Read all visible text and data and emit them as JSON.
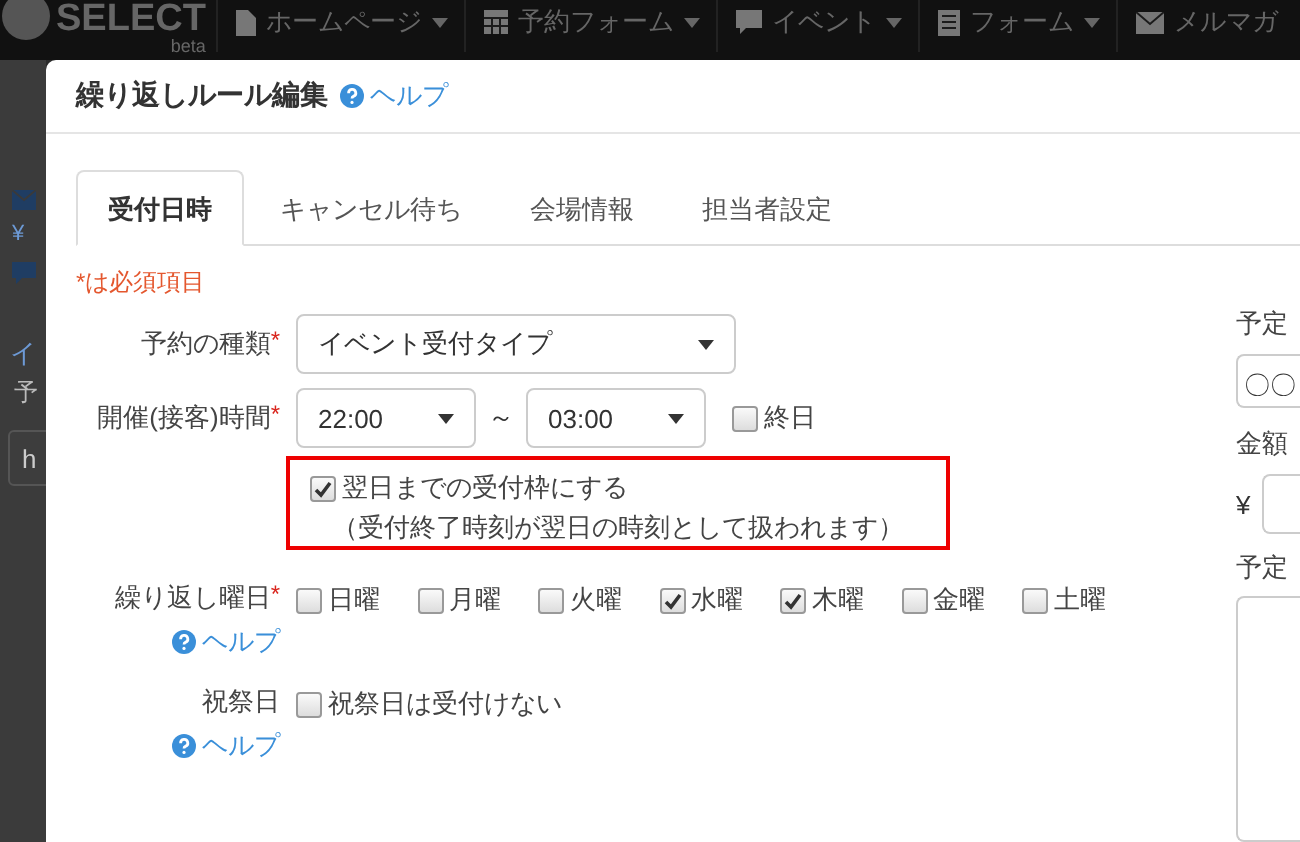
{
  "navbar": {
    "logo": "SELECT",
    "logo_sub": "beta",
    "items": [
      {
        "label": "ホームページ"
      },
      {
        "label": "予約フォーム"
      },
      {
        "label": "イベント"
      },
      {
        "label": "フォーム"
      },
      {
        "label": "メルマガ"
      }
    ]
  },
  "backdrop": {
    "currency": "¥",
    "texts": [
      "イ",
      "予"
    ],
    "field_value": "h"
  },
  "modal": {
    "title": "繰り返しルール編集",
    "help": "ヘルプ",
    "tabs": [
      {
        "label": "受付日時",
        "selected": true
      },
      {
        "label": "キャンセル待ち",
        "selected": false
      },
      {
        "label": "会場情報",
        "selected": false
      },
      {
        "label": "担当者設定",
        "selected": false
      }
    ],
    "required_note": "*は必須項目",
    "reservation_type": {
      "label": "予約の種類",
      "required_mark": "*",
      "value": "イベント受付タイプ"
    },
    "time": {
      "label": "開催(接客)時間",
      "required_mark": "*",
      "start": "22:00",
      "separator": "～",
      "end": "03:00",
      "all_day": {
        "label": "終日",
        "checked": false
      }
    },
    "overnight": {
      "label": "翌日までの受付枠にする",
      "checked": true,
      "note": "（受付終了時刻が翌日の時刻として扱われます）"
    },
    "weekdays": {
      "label": "繰り返し曜日",
      "required_mark": "*",
      "help": "ヘルプ",
      "days": [
        {
          "label": "日曜",
          "checked": false
        },
        {
          "label": "月曜",
          "checked": false
        },
        {
          "label": "火曜",
          "checked": false
        },
        {
          "label": "水曜",
          "checked": true
        },
        {
          "label": "木曜",
          "checked": true
        },
        {
          "label": "金曜",
          "checked": false
        },
        {
          "label": "土曜",
          "checked": false
        }
      ]
    },
    "holidays": {
      "label": "祝祭日",
      "help": "ヘルプ",
      "option": {
        "label": "祝祭日は受付けない",
        "checked": false
      }
    },
    "side": {
      "schedule_label": "予定",
      "schedule_value": "〇〇",
      "price_label": "金額",
      "currency": "¥",
      "detail_label": "予定"
    }
  }
}
